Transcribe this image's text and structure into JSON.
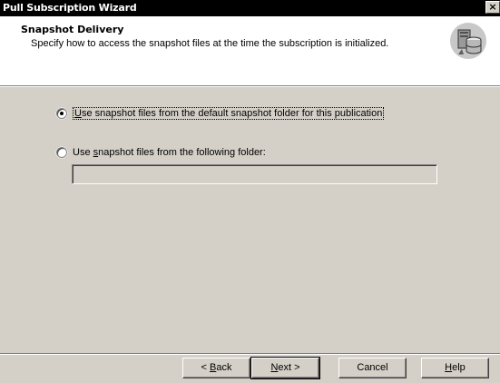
{
  "window": {
    "title": "Pull Subscription Wizard",
    "close_glyph": "×"
  },
  "header": {
    "title": "Snapshot Delivery",
    "subtitle": "Specify how to access the snapshot files at the time the subscription is initialized.",
    "icon": "database-server-icon"
  },
  "options": [
    {
      "label_pre": "",
      "label_mnemonic": "U",
      "label_post": "se snapshot files from the default snapshot folder for this publication",
      "selected": true
    },
    {
      "label_pre": "Use ",
      "label_mnemonic": "s",
      "label_post": "napshot files from the following folder:",
      "selected": false
    }
  ],
  "folder_input": {
    "value": "",
    "enabled": false
  },
  "buttons": {
    "back": {
      "pre": "< ",
      "mnemonic": "B",
      "post": "ack"
    },
    "next": {
      "pre": "",
      "mnemonic": "N",
      "post": "ext >"
    },
    "cancel": {
      "label": "Cancel"
    },
    "help": {
      "pre": "",
      "mnemonic": "H",
      "post": "elp"
    }
  }
}
